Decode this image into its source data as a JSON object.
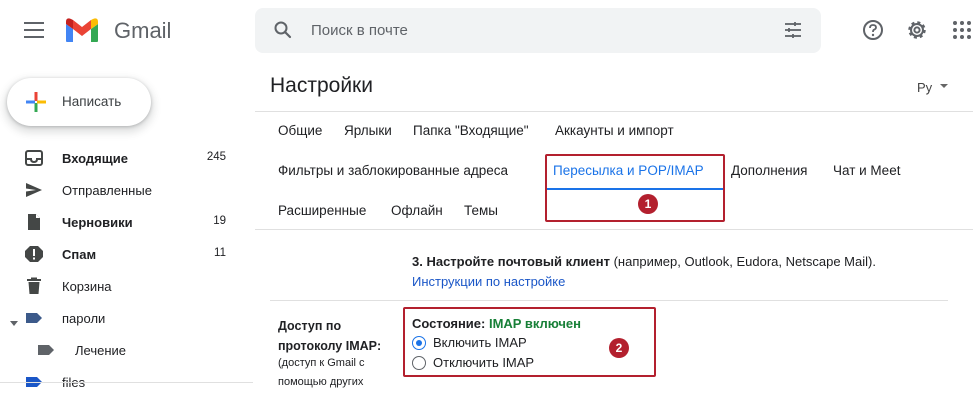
{
  "header": {
    "app_name": "Gmail",
    "search_placeholder": "Поиск в почте"
  },
  "sidebar": {
    "compose_label": "Написать",
    "items": [
      {
        "label": "Входящие",
        "count": "245",
        "bold": true,
        "icon": "inbox-icon"
      },
      {
        "label": "Отправленные",
        "count": "",
        "bold": false,
        "icon": "send-icon"
      },
      {
        "label": "Черновики",
        "count": "19",
        "bold": true,
        "icon": "draft-icon"
      },
      {
        "label": "Спам",
        "count": "11",
        "bold": true,
        "icon": "spam-icon"
      },
      {
        "label": "Корзина",
        "count": "",
        "bold": false,
        "icon": "trash-icon"
      },
      {
        "label": "пароли",
        "count": "",
        "bold": false,
        "icon": "label-icon"
      },
      {
        "label": "Лечение",
        "count": "",
        "bold": false,
        "icon": "label-icon"
      },
      {
        "label": "files",
        "count": "",
        "bold": false,
        "icon": "label-icon"
      }
    ]
  },
  "main": {
    "title": "Настройки",
    "language": "Ру",
    "tabs": [
      {
        "label": "Общие"
      },
      {
        "label": "Ярлыки"
      },
      {
        "label": "Папка \"Входящие\""
      },
      {
        "label": "Аккаунты и импорт"
      },
      {
        "label": "Фильтры и заблокированные адреса"
      },
      {
        "label": "Пересылка и POP/IMAP",
        "active": true
      },
      {
        "label": "Дополнения"
      },
      {
        "label": "Чат и Meet"
      },
      {
        "label": "Расширенные"
      },
      {
        "label": "Офлайн"
      },
      {
        "label": "Темы"
      }
    ],
    "badge_1": "1",
    "badge_2": "2",
    "client_step_bold": "3. Настройте почтовый клиент",
    "client_step_rest": " (например, Outlook, Eudora, Netscape Mail).",
    "client_link": "Инструкции по настройке",
    "imap_label": "Доступ по протоколу IMAP:",
    "imap_sublabel": "(доступ к Gmail с помощью других",
    "status_prefix": "Состояние: ",
    "status_value": "IMAP включен",
    "options": [
      {
        "label": "Включить IMAP",
        "checked": true
      },
      {
        "label": "Отключить IMAP",
        "checked": false
      }
    ]
  },
  "colors": {
    "accent": "#1a73e8",
    "status_green": "#188038",
    "highlight_red": "#b3202e"
  }
}
